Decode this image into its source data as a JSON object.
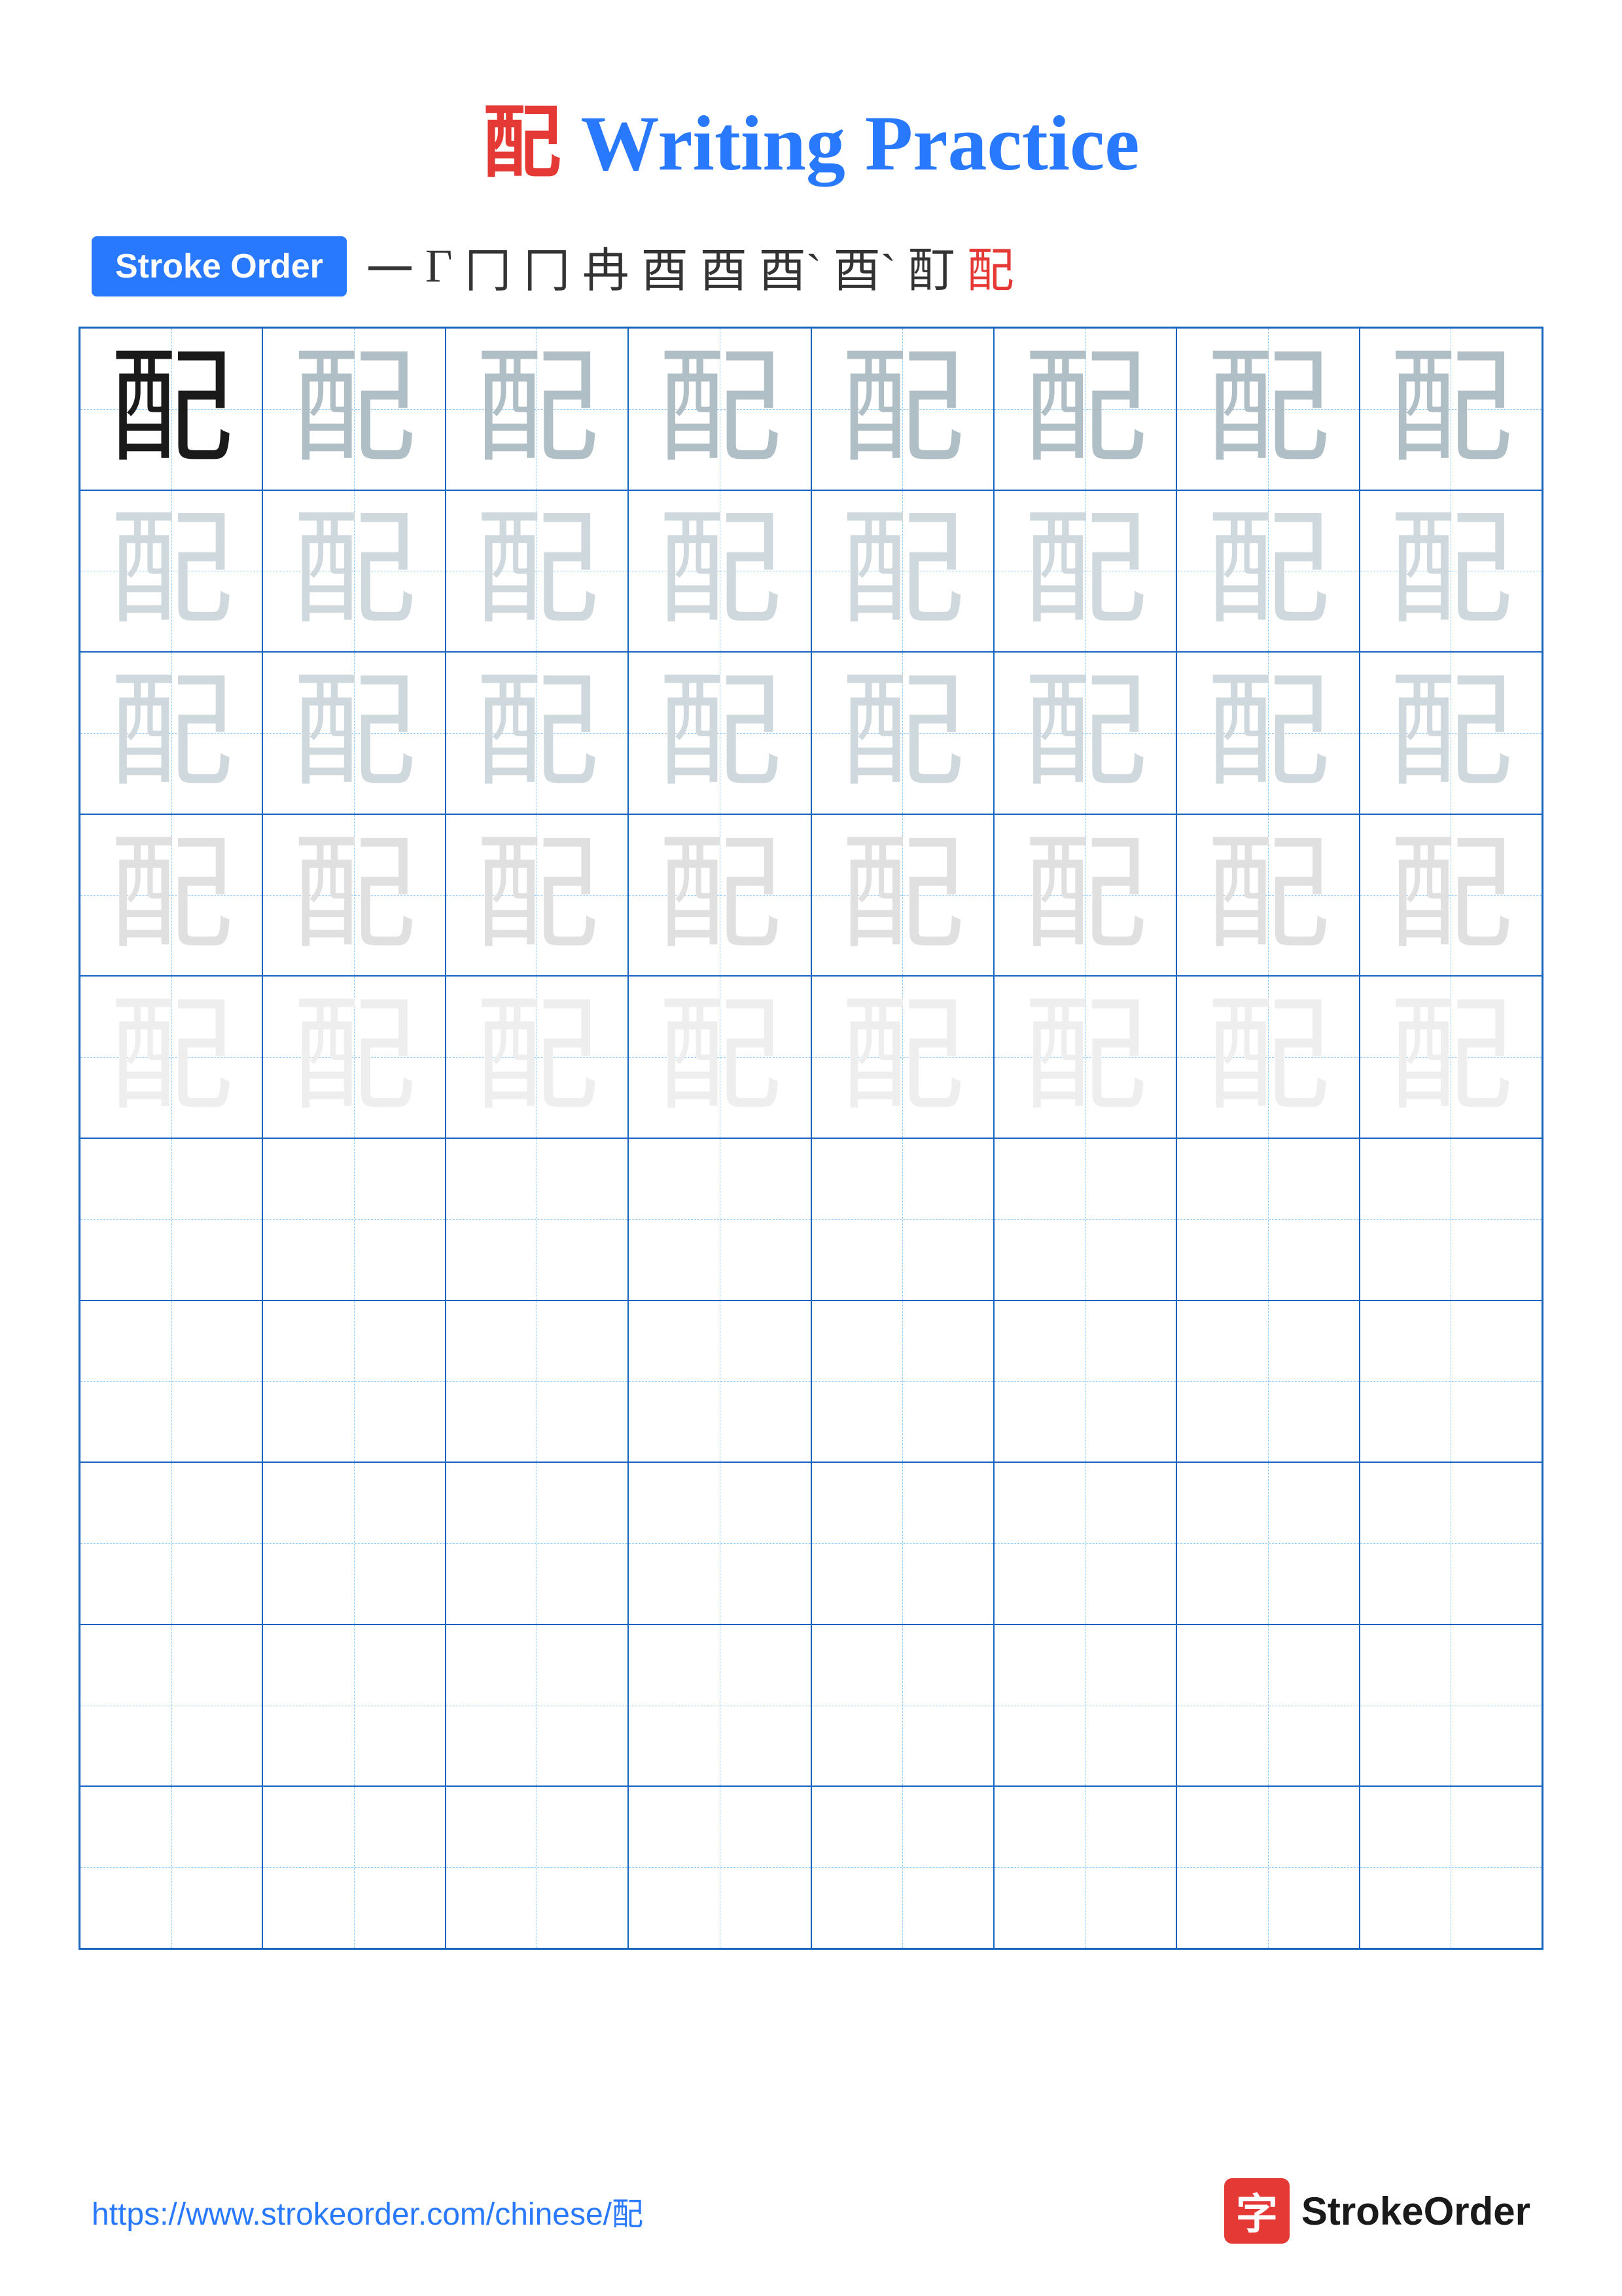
{
  "title": {
    "character": "配",
    "text": " Writing Practice",
    "full": "配 Writing Practice"
  },
  "stroke_order": {
    "badge_label": "Stroke Order",
    "strokes": [
      "㇐",
      "㇗",
      "冂",
      "冂",
      "冉",
      "酉",
      "酉",
      "酉`",
      "酉`",
      "酊",
      "配"
    ]
  },
  "character": "配",
  "grid": {
    "rows": 10,
    "cols": 8
  },
  "footer": {
    "url": "https://www.strokeorder.com/chinese/配",
    "logo_char": "字",
    "logo_text": "StrokeOrder"
  }
}
